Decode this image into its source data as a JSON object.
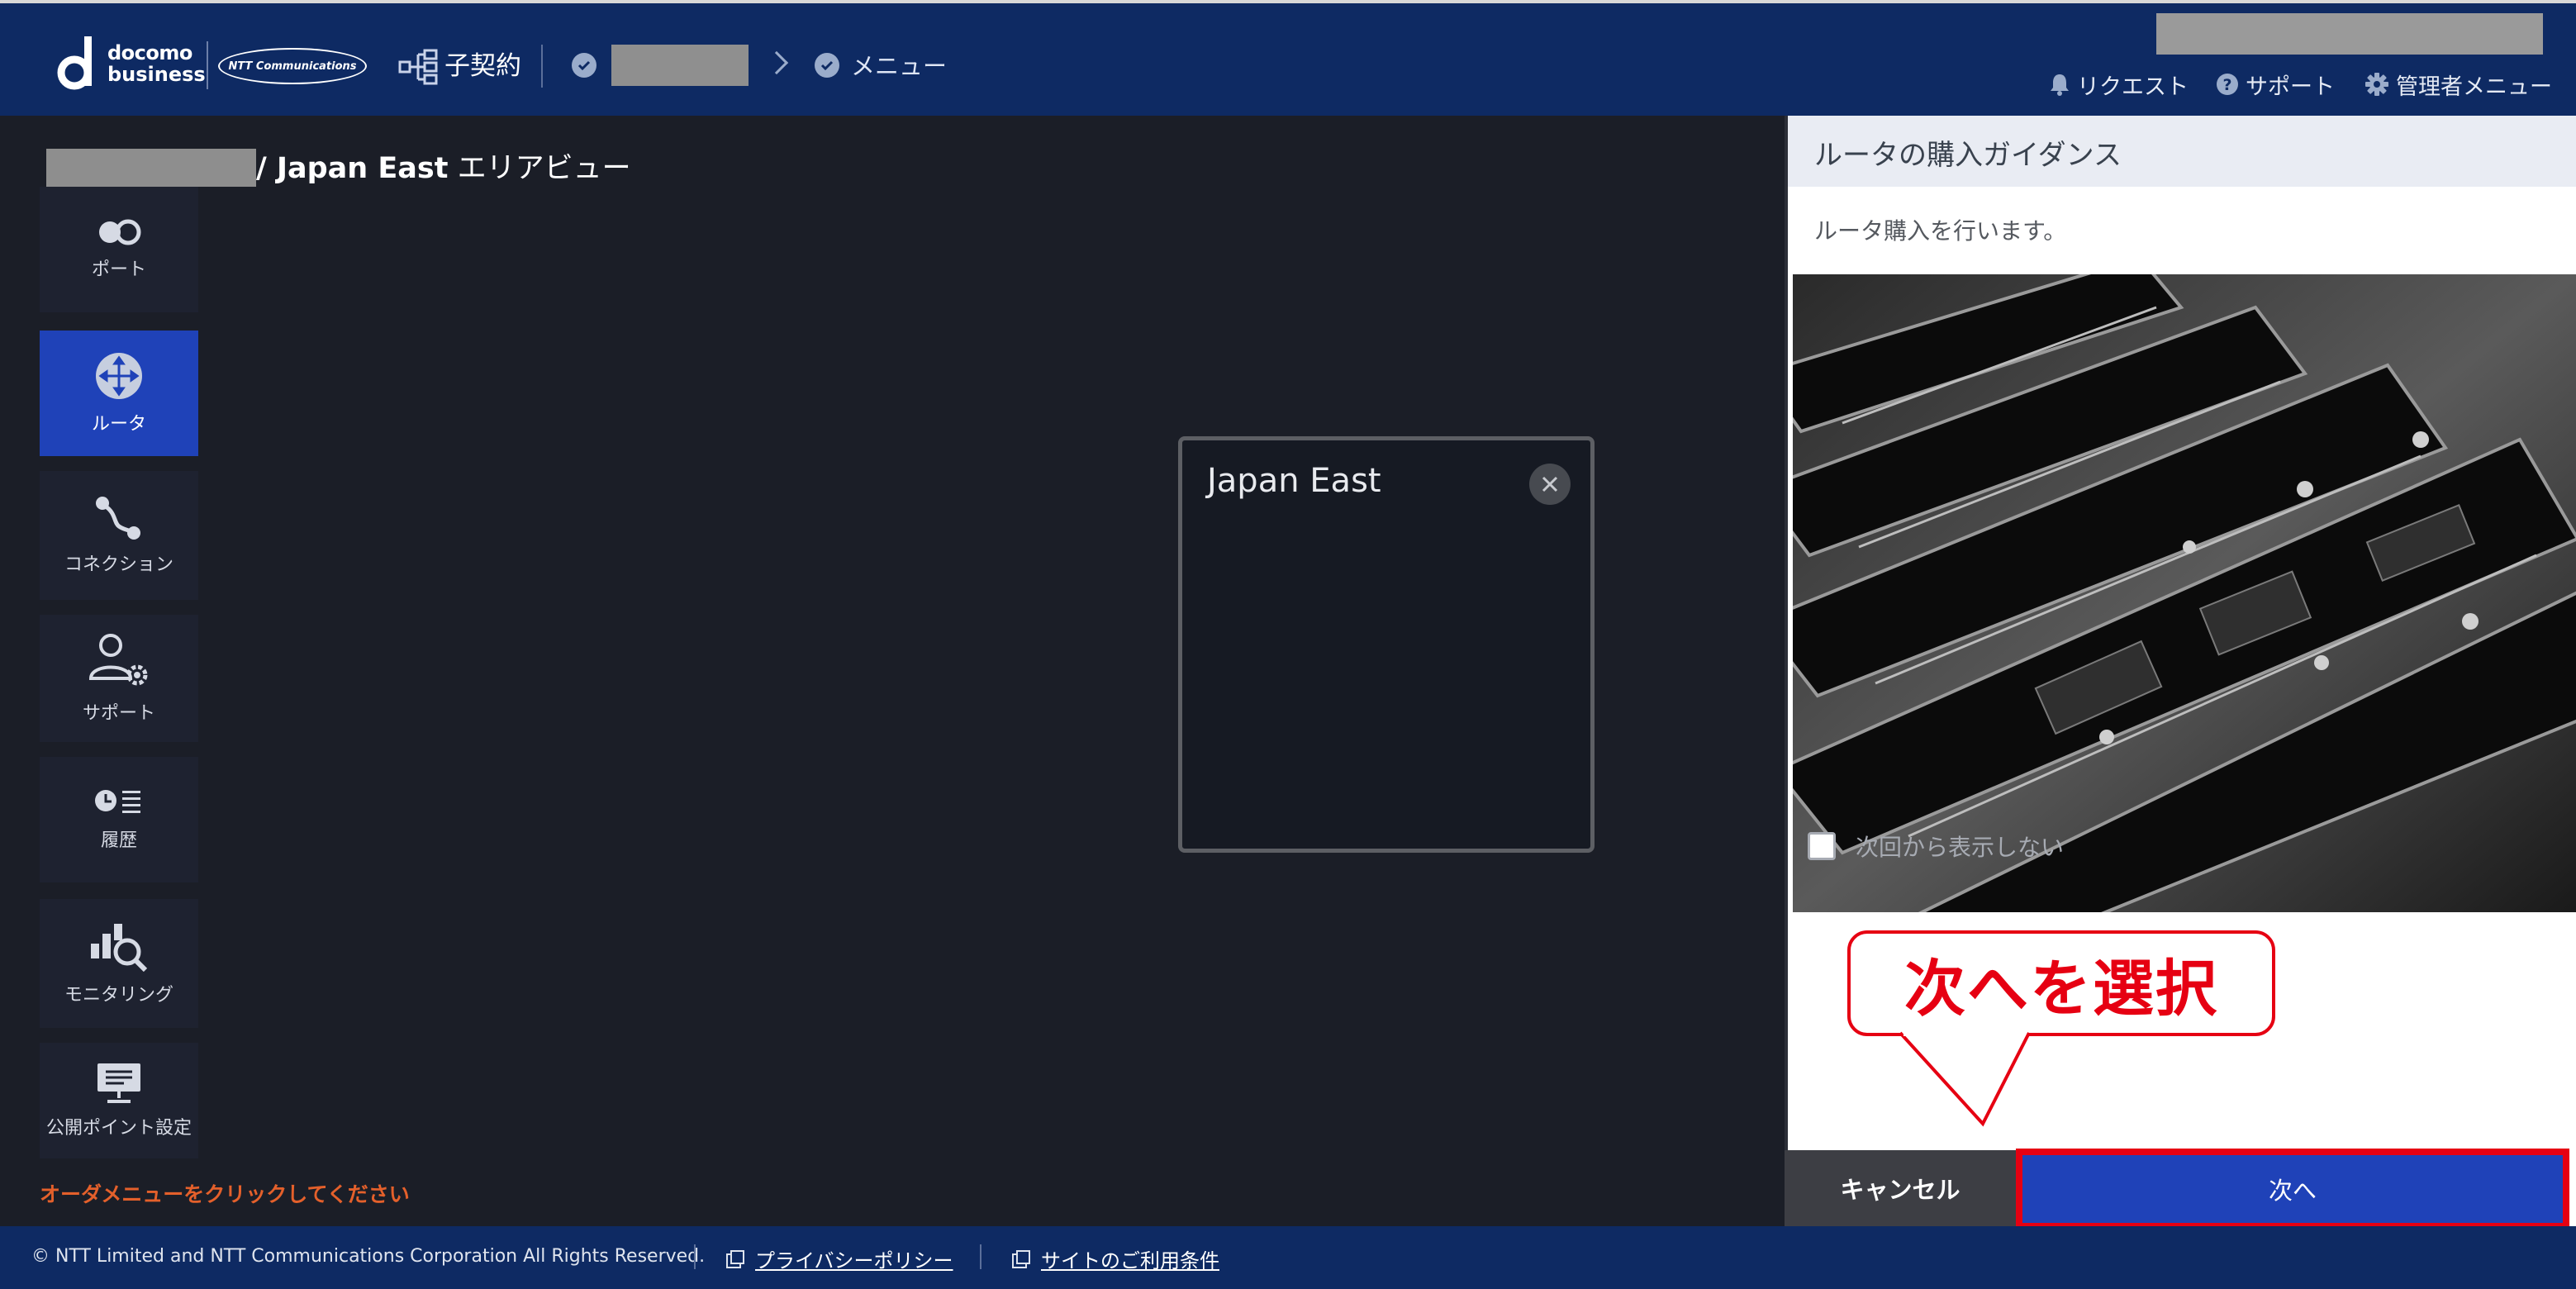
{
  "header": {
    "brand_top": "docomo",
    "brand_bottom": "business",
    "partner_logo": "NTT Communications",
    "contract_label": "子契約",
    "menu_label": "メニュー",
    "links": {
      "request": "リクエスト",
      "support": "サポート",
      "admin_menu": "管理者メニュー"
    }
  },
  "page": {
    "title_area": "/ Japan East",
    "title_view": "エリアビュー"
  },
  "sidebar": {
    "items": [
      {
        "label": "ポート",
        "icon": "port-icon"
      },
      {
        "label": "ルータ",
        "icon": "router-icon",
        "active": true
      },
      {
        "label": "コネクション",
        "icon": "connection-icon"
      },
      {
        "label": "サポート",
        "icon": "support-icon"
      },
      {
        "label": "履歴",
        "icon": "history-icon"
      },
      {
        "label": "モニタリング",
        "icon": "monitoring-icon"
      },
      {
        "label": "公開ポイント設定",
        "icon": "public-point-icon"
      }
    ],
    "order_hint": "オーダメニューをクリックしてください"
  },
  "region_popup": {
    "name": "Japan East"
  },
  "guide": {
    "title": "ルータの購入ガイダンス",
    "description": "ルータ購入を行います。",
    "dont_show_label": "次回から表示しない",
    "cancel_label": "キャンセル",
    "next_label": "次へ"
  },
  "annotation": {
    "callout_text": "次へを選択"
  },
  "footer": {
    "copyright": "© NTT Limited and NTT Communications Corporation All Rights Reserved.",
    "privacy": "プライバシーポリシー",
    "terms": "サイトのご利用条件"
  },
  "colors": {
    "header_bg": "#0e2a63",
    "accent_blue": "#1f42b8",
    "alert_red": "#e60012",
    "hint_orange": "#e4602b"
  }
}
